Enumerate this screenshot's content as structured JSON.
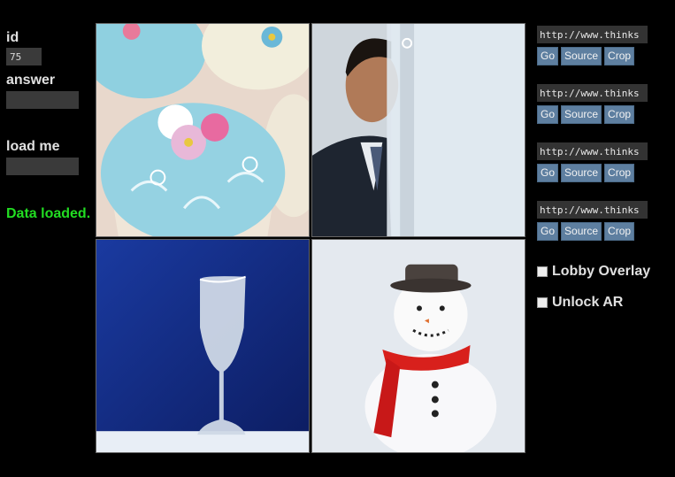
{
  "form": {
    "id_label": "id",
    "id_value": "75",
    "answer_label": "answer",
    "answer_value": "",
    "load_label": "load me",
    "load_value": "",
    "status": "Data loaded."
  },
  "images": [
    {
      "subject": "cupcakes"
    },
    {
      "subject": "businessman-behind-frosted-glass"
    },
    {
      "subject": "frosted-wine-glass"
    },
    {
      "subject": "snowman-in-snow"
    }
  ],
  "slots": [
    {
      "url": "http://www.thinks",
      "go": "Go",
      "source": "Source",
      "crop": "Crop"
    },
    {
      "url": "http://www.thinks",
      "go": "Go",
      "source": "Source",
      "crop": "Crop"
    },
    {
      "url": "http://www.thinks",
      "go": "Go",
      "source": "Source",
      "crop": "Crop"
    },
    {
      "url": "http://www.thinks",
      "go": "Go",
      "source": "Source",
      "crop": "Crop"
    }
  ],
  "toggles": [
    {
      "label": "Lobby Overlay",
      "checked": false
    },
    {
      "label": "Unlock AR",
      "checked": false
    }
  ],
  "colors": {
    "status": "#22dd22",
    "button": "#5e7fa0",
    "field": "#3a3a3a",
    "background": "#000000"
  }
}
